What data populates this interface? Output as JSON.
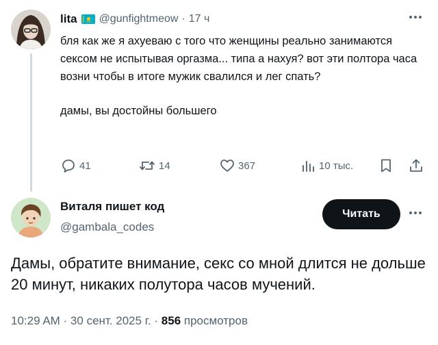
{
  "parent_tweet": {
    "author_name": "lita",
    "flag": "kazakhstan-flag",
    "handle": "@gunfightmeow",
    "separator": "·",
    "time": "17 ч",
    "text_paragraphs": [
      "бля как же я ахуеваю с того что женщины реально занимаются сексом не испытывая оргазма... типа а нахуя? вот эти полтора часа возни чтобы в итоге мужик свалился и лег спать?",
      "дамы, вы достойны большего"
    ],
    "actions": {
      "replies": "41",
      "reposts": "14",
      "likes": "367",
      "views": "10 тыс."
    }
  },
  "main_tweet": {
    "author_name": "Виталя пишет код",
    "handle": "@gambala_codes",
    "read_button_label": "Читать",
    "text": "Дамы, обратите внимание, секс со мной длится не дольше 20 минут, никаких полутора часов мучений.",
    "timestamp": "10:29 AM · 30 сент. 2025 г. ·",
    "views_count": "856",
    "views_label": "просмотров"
  },
  "colors": {
    "text_primary": "#0f1419",
    "text_secondary": "#536471",
    "thread_line": "#cfd9de",
    "button_bg": "#0f1419",
    "flag_blue": "#00afca",
    "flag_gold": "#fec50c"
  },
  "icons": [
    "reply-icon",
    "repost-icon",
    "like-icon",
    "views-icon",
    "bookmark-icon",
    "share-icon",
    "more-icon"
  ]
}
